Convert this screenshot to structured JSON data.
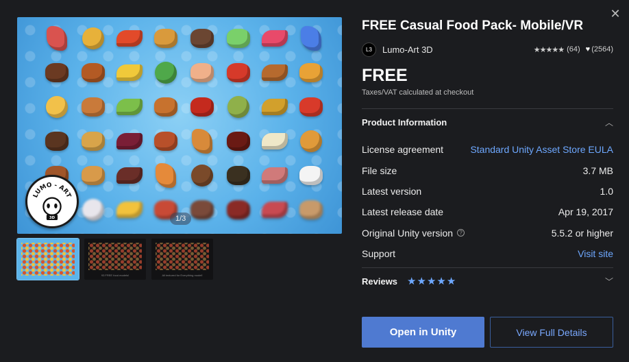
{
  "colors": {
    "background": "#1b1c1f",
    "accent": "#4f7ad1",
    "link": "#6ea8ff",
    "hero_bg": "#5bb2ea"
  },
  "icons": {
    "close": "close-icon",
    "heart": "heart-icon",
    "help": "help-circle-icon",
    "chevron_up": "chevron-up-icon",
    "chevron_down": "chevron-down-icon"
  },
  "media": {
    "pager": "1/3",
    "logo_text": "LUMO - ART 3D",
    "food_colors": [
      "#d9534f",
      "#e7b13a",
      "#e24a2a",
      "#d99a3c",
      "#6b4632",
      "#7ad06a",
      "#e84a6a",
      "#4b7ee6",
      "#6b3a22",
      "#b35a24",
      "#f0c93a",
      "#4fa84a",
      "#f0b08a",
      "#d63a2a",
      "#b66a2e",
      "#e8a236",
      "#f2c14a",
      "#c97a3a",
      "#7cbf4a",
      "#c7722e",
      "#c42a1e",
      "#8fb04a",
      "#d2a02c",
      "#d83a2a",
      "#5a3520",
      "#d8a44a",
      "#7a1e36",
      "#b8502a",
      "#d88a3a",
      "#6a1a14",
      "#efe8c8",
      "#e09a3a",
      "#a0562a",
      "#d89a4a",
      "#6a2e28",
      "#e58a3a",
      "#7a4a2a",
      "#3a3020",
      "#d07a7a",
      "#f4f4f4",
      "#e0a86a",
      "#e8e6ec",
      "#f2c23c",
      "#c84a36",
      "#7a4a3a",
      "#8a2a26",
      "#c84a52",
      "#c89a6a"
    ]
  },
  "thumbs": [
    {
      "caption": ""
    },
    {
      "caption": "93 FREE food models!"
    },
    {
      "caption": "All textured for Everything model!"
    }
  ],
  "product": {
    "title": "FREE Casual Food Pack- Mobile/VR",
    "publisher_initials": "L3",
    "publisher_name": "Lumo-Art 3D",
    "stars": "★★★★★",
    "rating_count": "(64)",
    "favorites": "(2564)",
    "price": "FREE",
    "tax_note": "Taxes/VAT calculated at checkout"
  },
  "product_info": {
    "heading": "Product Information",
    "rows": [
      {
        "label": "License agreement",
        "value": "Standard Unity Asset Store EULA",
        "link": true
      },
      {
        "label": "File size",
        "value": "3.7 MB",
        "link": false
      },
      {
        "label": "Latest version",
        "value": "1.0",
        "link": false
      },
      {
        "label": "Latest release date",
        "value": "Apr 19, 2017",
        "link": false
      },
      {
        "label": "Original Unity version",
        "value": "5.5.2 or higher",
        "link": false,
        "help": true
      },
      {
        "label": "Support",
        "value": "Visit site",
        "link": true
      }
    ]
  },
  "reviews": {
    "heading": "Reviews",
    "stars": "★★★★★"
  },
  "actions": {
    "open_in_unity": "Open in Unity",
    "view_full_details": "View Full Details"
  }
}
